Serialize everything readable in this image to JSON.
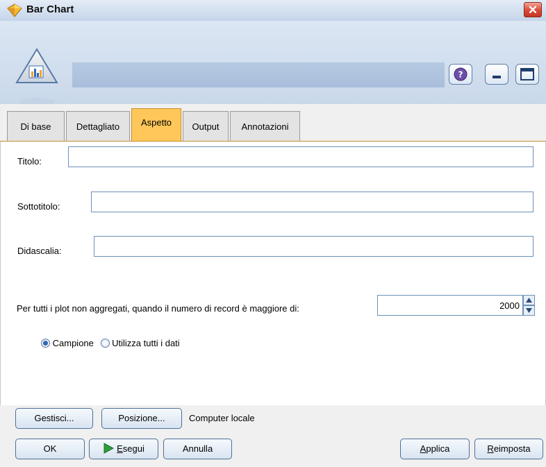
{
  "window": {
    "title": "Bar Chart"
  },
  "tabs": [
    {
      "label": "Di base"
    },
    {
      "label": "Dettagliato"
    },
    {
      "label": "Aspetto",
      "active": true
    },
    {
      "label": "Output"
    },
    {
      "label": "Annotazioni"
    }
  ],
  "form": {
    "title_label": "Titolo:",
    "title_value": "",
    "subtitle_label": "Sottotitolo:",
    "subtitle_value": "",
    "caption_label": "Didascalia:",
    "caption_value": "",
    "threshold_label": "Per tutti i plot non aggregati, quando il numero di record è maggiore di:",
    "threshold_value": "2000",
    "radio_sample": "Campione",
    "radio_all": "Utilizza tutti i dati",
    "selected_radio": "Campione"
  },
  "footer": {
    "manage_button": "Gestisci...",
    "location_button": "Posizione...",
    "location_text": "Computer locale",
    "ok_button": "OK",
    "run_button_first": "E",
    "run_button_rest": "segui",
    "cancel_button": "Annulla",
    "apply_button_first": "A",
    "apply_button_rest": "pplica",
    "reset_button_first": "R",
    "reset_button_rest": "eimposta"
  },
  "colors": {
    "active_tab": "#ffc75a",
    "close_button": "#d94a37",
    "run_arrow": "#2e9e3c"
  },
  "icons": [
    "app-diamond-icon",
    "bar-chart-node-icon",
    "help-icon",
    "minimize-icon",
    "maximize-icon",
    "close-icon",
    "run-arrow-icon"
  ]
}
